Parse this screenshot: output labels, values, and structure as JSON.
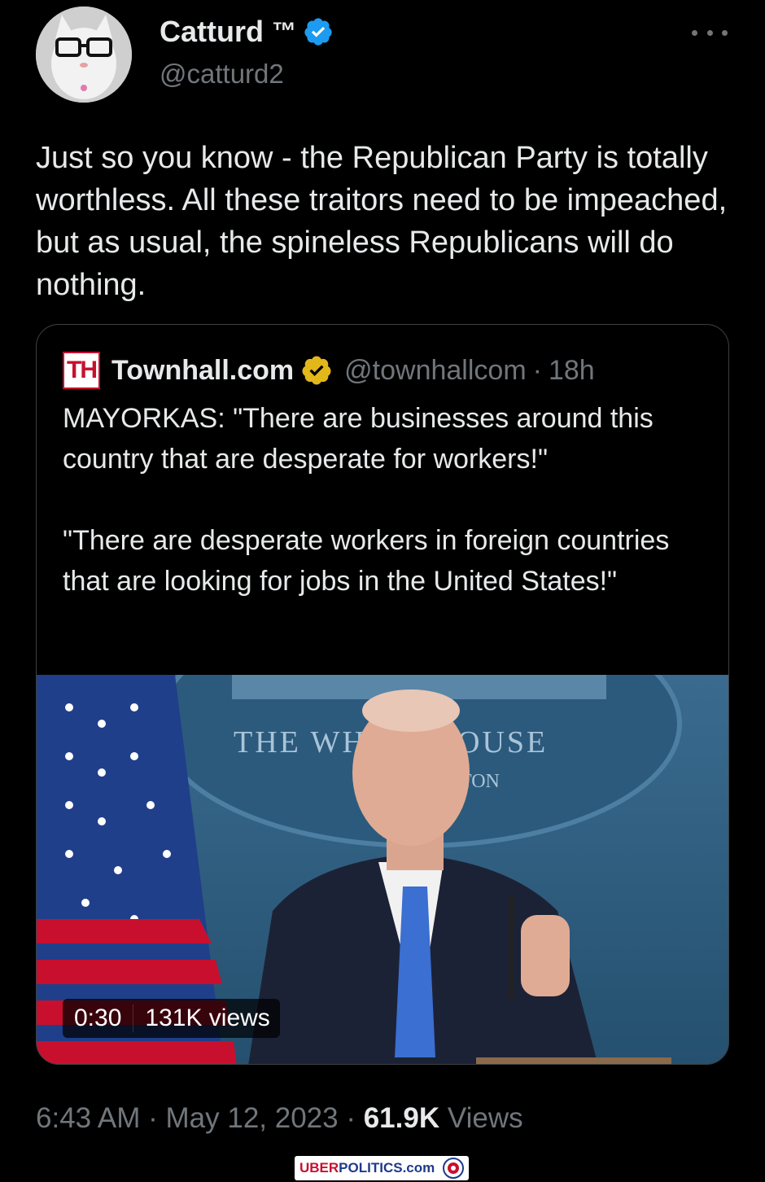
{
  "tweet": {
    "author": {
      "display_name": "Catturd",
      "tm": "™",
      "handle": "@catturd2",
      "avatar_icon": "cat-with-glasses-avatar"
    },
    "text": "Just so you know - the Republican Party is totally worthless. All these traitors need to be impeached, but as usual, the spineless Republicans will do nothing.",
    "timestamp": "6:43 AM · May 12, 2023",
    "views_count": "61.9K",
    "views_label": "Views"
  },
  "quoted_tweet": {
    "logo_text": "TH",
    "display_name": "Townhall.com",
    "handle": "@townhallcom",
    "age": "18h",
    "text": "MAYORKAS: \"There are businesses around this country that are desperate for workers!\"\n\n\"There are desperate workers in foreign countries that are looking for jobs in the United States!\"",
    "video": {
      "duration": "0:30",
      "views": "131K views",
      "backdrop_text": "THE WHITE HOUSE",
      "backdrop_sub": "TON"
    }
  },
  "watermark": {
    "uber": "UBER",
    "politics": "POLITICS",
    "domain": ".com"
  },
  "colors": {
    "background": "#000000",
    "text": "#e7e9ea",
    "secondary": "#71767b",
    "verified_blue": "#1d9bf0",
    "verified_gold": "#e2b719"
  }
}
